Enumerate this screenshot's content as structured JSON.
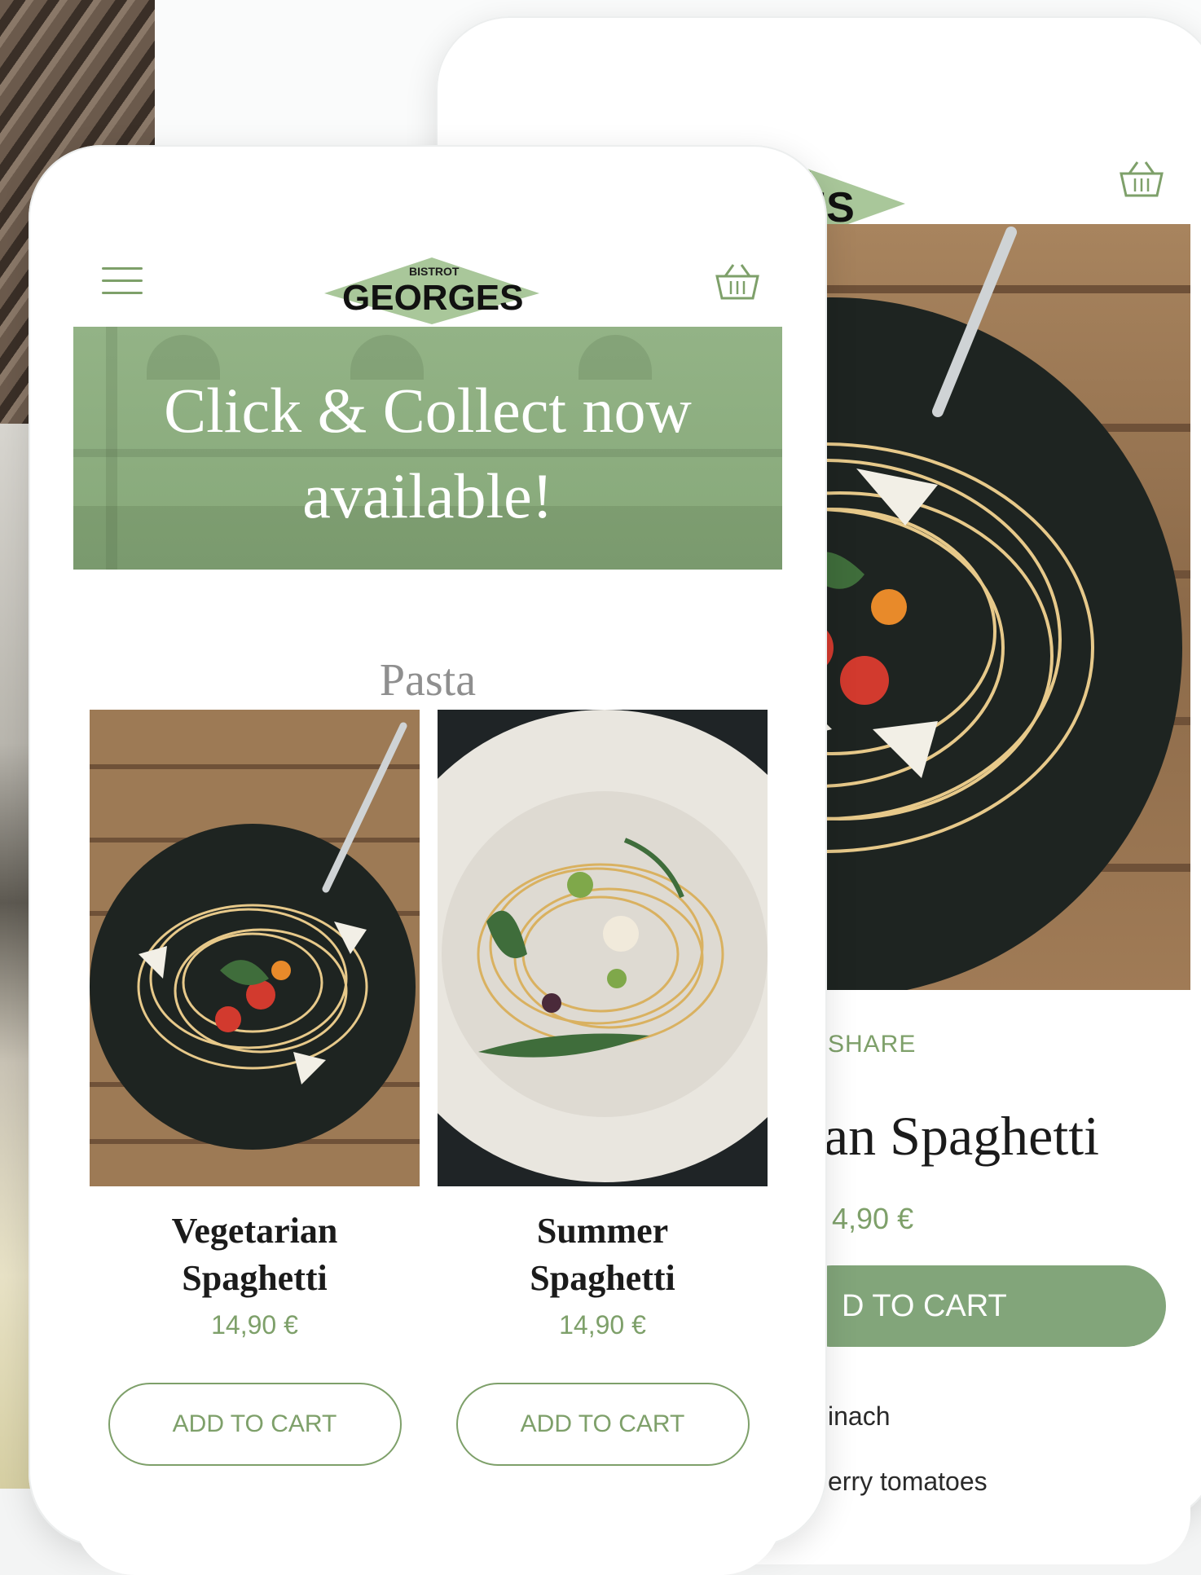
{
  "brand": {
    "small": "BISTROT",
    "name": "GEORGES",
    "accent": "#7ea06a",
    "logo_green": "#a9c79a"
  },
  "front": {
    "banner_line1": "Click & Collect now",
    "banner_line2": "available!",
    "section_title": "Pasta",
    "products": [
      {
        "name_line1": "Vegetarian",
        "name_line2": "Spaghetti",
        "price": "14,90 €",
        "button": "ADD TO CART"
      },
      {
        "name_line1": "Summer",
        "name_line2": "Spaghetti",
        "price": "14,90 €",
        "button": "ADD TO CART"
      }
    ]
  },
  "back": {
    "logo_visible": "ORGES",
    "share": "SHARE",
    "title": "an Spaghetti",
    "price": "4,90 €",
    "button": "D TO CART",
    "ingredients": [
      "inach",
      "erry tomatoes"
    ]
  },
  "icons": {
    "menu": "hamburger-icon",
    "cart": "basket-icon"
  }
}
